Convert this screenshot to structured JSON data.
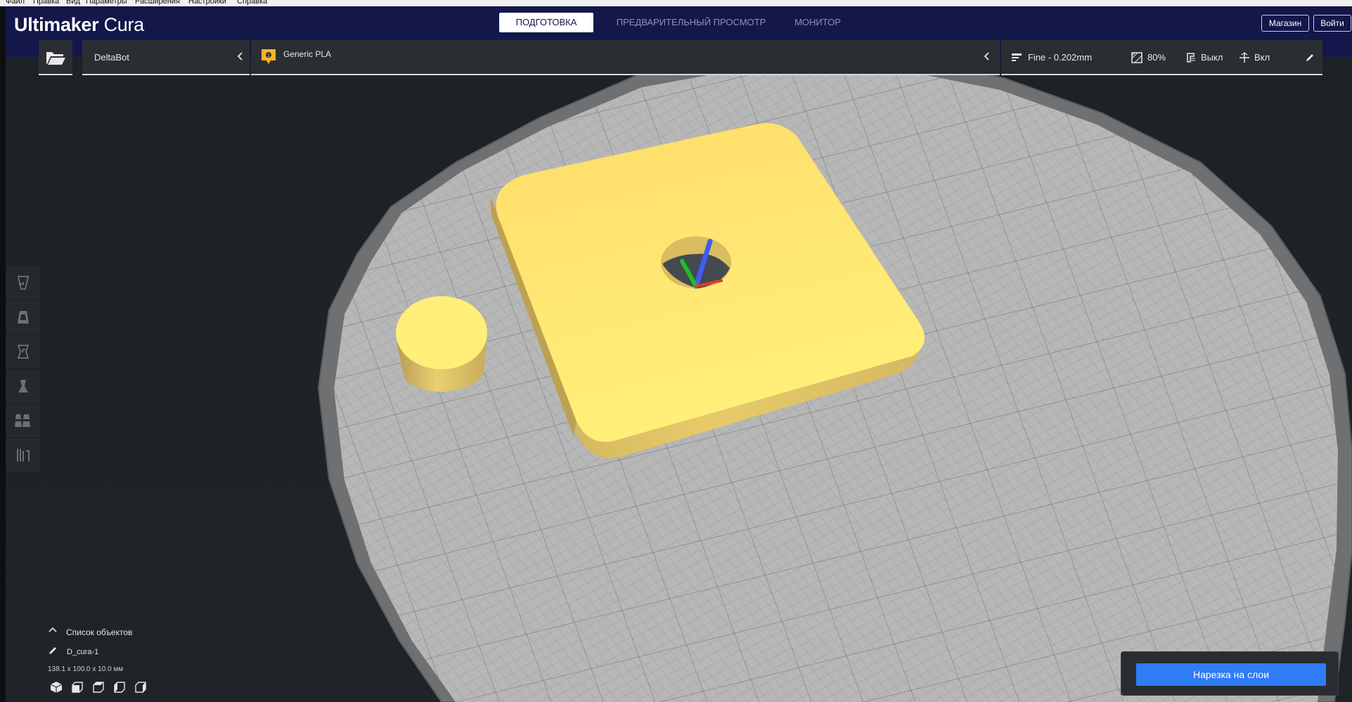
{
  "menu": {
    "items": [
      "Файл",
      "Правка",
      "Вид",
      "Параметры",
      "Расширения",
      "Настройки",
      "Справка"
    ]
  },
  "app": {
    "brand_bold": "Ultimaker",
    "brand_light": "Cura"
  },
  "stages": {
    "prepare": "ПОДГОТОВКА",
    "preview": "ПРЕДВАРИТЕЛЬНЫЙ ПРОСМОТР",
    "monitor": "МОНИТОР"
  },
  "header": {
    "marketplace": "Магазин",
    "signin": "Войти"
  },
  "toolbar": {
    "printer": "DeltaBot",
    "material": "Generic PLA",
    "profile": "Fine - 0.202mm",
    "infill": "80%",
    "support": "Выкл",
    "adhesion": "Вкл"
  },
  "object_list": {
    "title": "Список объектов",
    "object_name": "D_cura-1",
    "dimensions": "138.1 x 100.0 x 10.0 мм"
  },
  "slice": {
    "button": "Нарезка на слои"
  },
  "colors": {
    "header_bg": "#13174a",
    "model_yellow": "#ffe873",
    "slice_blue": "#2e7cf6",
    "material_badge": "#f6b327"
  },
  "icons": {
    "open": "folder-open-icon",
    "profile": "profile-bars-icon",
    "infill": "infill-icon",
    "support": "support-icon",
    "adhesion": "adhesion-icon",
    "edit": "pencil-icon"
  }
}
